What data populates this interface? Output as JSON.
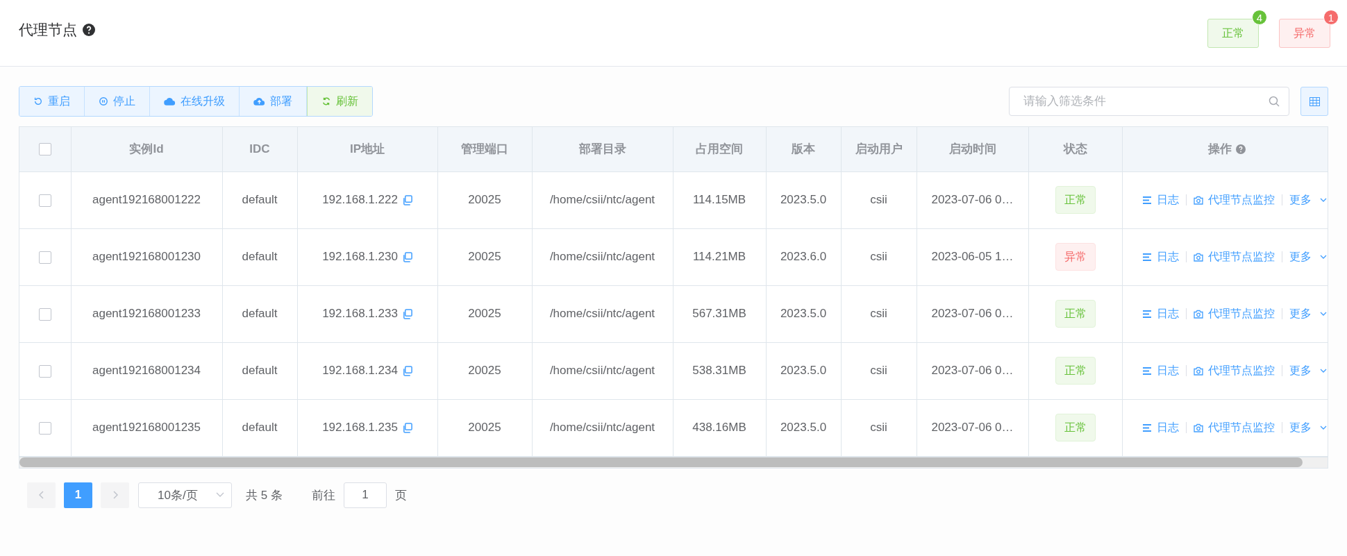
{
  "page": {
    "title": "代理节点"
  },
  "summary": [
    {
      "kind": "normal",
      "label": "正常",
      "count": "4"
    },
    {
      "kind": "abnormal",
      "label": "异常",
      "count": "1"
    }
  ],
  "toolbar": [
    {
      "kind": "restart",
      "label": "重启"
    },
    {
      "kind": "stop",
      "label": "停止"
    },
    {
      "kind": "upgrade",
      "label": "在线升级"
    },
    {
      "kind": "deploy",
      "label": "部署"
    },
    {
      "kind": "refresh",
      "label": "刷新"
    }
  ],
  "search": {
    "placeholder": "请输入筛选条件"
  },
  "table": {
    "select_all": {
      "checked": false
    },
    "columns": [
      "实例Id",
      "IDC",
      "IP地址",
      "管理端口",
      "部署目录",
      "占用空间",
      "版本",
      "启动用户",
      "启动时间",
      "状态",
      "操作"
    ],
    "rows": [
      {
        "checked": false,
        "cells": [
          "agent192168001222",
          "default",
          "192.168.1.222",
          "20025",
          "/home/csii/ntc/agent",
          "114.15MB",
          "2023.5.0",
          "csii",
          "2023-07-06 0…"
        ],
        "status": {
          "kind": "normal",
          "label": "正常"
        },
        "actions": [
          "日志",
          "代理节点监控",
          "更多"
        ]
      },
      {
        "checked": false,
        "cells": [
          "agent192168001230",
          "default",
          "192.168.1.230",
          "20025",
          "/home/csii/ntc/agent",
          "114.21MB",
          "2023.6.0",
          "csii",
          "2023-06-05 1…"
        ],
        "status": {
          "kind": "abnormal",
          "label": "异常"
        },
        "actions": [
          "日志",
          "代理节点监控",
          "更多"
        ]
      },
      {
        "checked": false,
        "cells": [
          "agent192168001233",
          "default",
          "192.168.1.233",
          "20025",
          "/home/csii/ntc/agent",
          "567.31MB",
          "2023.5.0",
          "csii",
          "2023-07-06 0…"
        ],
        "status": {
          "kind": "normal",
          "label": "正常"
        },
        "actions": [
          "日志",
          "代理节点监控",
          "更多"
        ]
      },
      {
        "checked": false,
        "cells": [
          "agent192168001234",
          "default",
          "192.168.1.234",
          "20025",
          "/home/csii/ntc/agent",
          "538.31MB",
          "2023.5.0",
          "csii",
          "2023-07-06 0…"
        ],
        "status": {
          "kind": "normal",
          "label": "正常"
        },
        "actions": [
          "日志",
          "代理节点监控",
          "更多"
        ]
      },
      {
        "checked": false,
        "cells": [
          "agent192168001235",
          "default",
          "192.168.1.235",
          "20025",
          "/home/csii/ntc/agent",
          "438.16MB",
          "2023.5.0",
          "csii",
          "2023-07-06 0…"
        ],
        "status": {
          "kind": "normal",
          "label": "正常"
        },
        "actions": [
          "日志",
          "代理节点监控",
          "更多"
        ]
      }
    ]
  },
  "pagination": {
    "pages": [
      {
        "label": "1",
        "selected": true
      }
    ],
    "page_size": "10条/页",
    "total": "共 5 条",
    "goto_label": "前往",
    "goto_value": "1",
    "goto_suffix": "页"
  }
}
